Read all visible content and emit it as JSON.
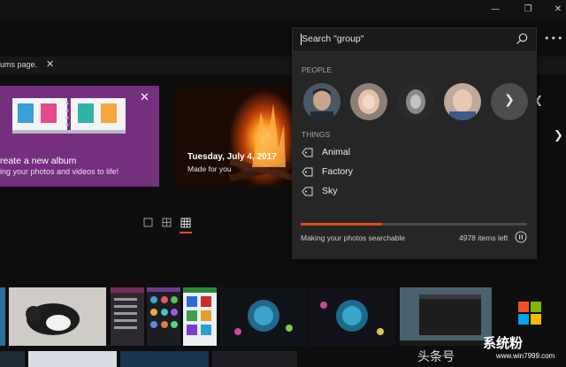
{
  "window": {
    "minimize_icon": "minimize-icon",
    "restore_icon": "restore-icon",
    "close_icon": "close-icon"
  },
  "notice": {
    "text": "ums page.",
    "close_icon": "close-icon"
  },
  "album_card": {
    "title": "reate a new album",
    "subtitle": "ing your photos and videos to life!",
    "background_color": "#74307f",
    "close_icon": "close-icon"
  },
  "memory_card": {
    "title": "Tuesday, July 4, 2017",
    "subtitle": "Made for you"
  },
  "search": {
    "value": "Search \"group\"",
    "icon": "search-icon",
    "more_icon": "more-icon"
  },
  "people": {
    "label": "PEOPLE",
    "next_icon": "chevron-right-icon"
  },
  "things": {
    "label": "THINGS",
    "items": [
      {
        "label": "Animal",
        "icon": "tag-icon"
      },
      {
        "label": "Factory",
        "icon": "tag-icon"
      },
      {
        "label": "Sky",
        "icon": "tag-icon"
      }
    ]
  },
  "indexing": {
    "status": "Making your photos searchable",
    "items_left": "4978 items left",
    "progress_fraction": 0.36,
    "pause_icon": "pause-icon"
  },
  "view_toggles": [
    "large-thumbnails-icon",
    "medium-thumbnails-icon",
    "small-thumbnails-icon"
  ],
  "branding": {
    "logo_text": "系统粉",
    "logo_url": "www.win7999.com",
    "watermark": "头条号"
  },
  "colors": {
    "accent": "#e8471d",
    "panel": "#262626",
    "background": "#0e0e0e"
  }
}
